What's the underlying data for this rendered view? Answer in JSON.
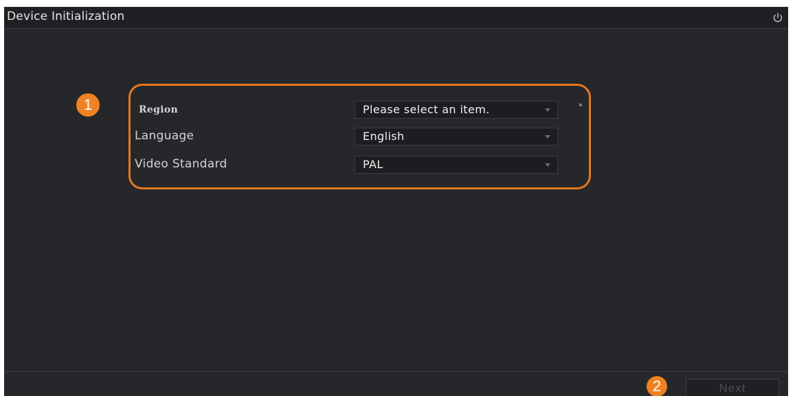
{
  "window": {
    "title": "Device Initialization"
  },
  "icons": {
    "power": "power-icon"
  },
  "form": {
    "region": {
      "label": "Region",
      "value": "Please select an item.",
      "required_mark": "*"
    },
    "language": {
      "label": "Language",
      "value": "English"
    },
    "video_standard": {
      "label": "Video Standard",
      "value": "PAL"
    }
  },
  "annotations": {
    "badge_1": "1",
    "badge_2": "2",
    "highlight_color": "#e8781e",
    "badge_color": "#f08223"
  },
  "footer": {
    "next_label": "Next"
  },
  "colors": {
    "background": "#26272b",
    "titlebar": "#1f2023",
    "text": "#d4d4d4"
  }
}
